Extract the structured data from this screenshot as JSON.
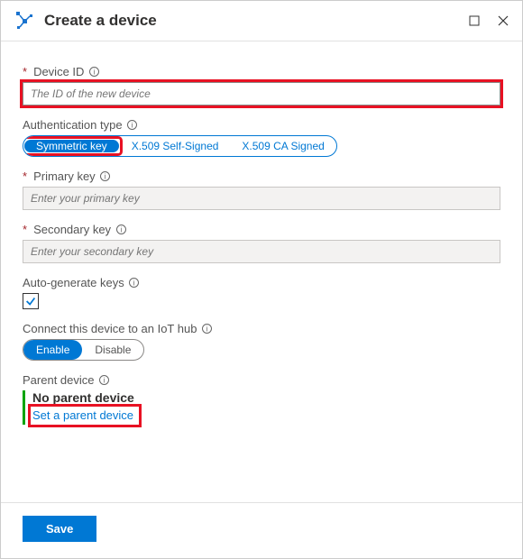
{
  "header": {
    "title": "Create a device"
  },
  "deviceId": {
    "label": "Device ID",
    "placeholder": "The ID of the new device"
  },
  "authType": {
    "label": "Authentication type",
    "options": [
      "Symmetric key",
      "X.509 Self-Signed",
      "X.509 CA Signed"
    ],
    "selected": "Symmetric key"
  },
  "primaryKey": {
    "label": "Primary key",
    "placeholder": "Enter your primary key"
  },
  "secondaryKey": {
    "label": "Secondary key",
    "placeholder": "Enter your secondary key"
  },
  "autoGenerate": {
    "label": "Auto-generate keys",
    "checked": true
  },
  "iotHub": {
    "label": "Connect this device to an IoT hub",
    "options": [
      "Enable",
      "Disable"
    ],
    "selected": "Enable"
  },
  "parentDevice": {
    "label": "Parent device",
    "status": "No parent device",
    "link": "Set a parent device"
  },
  "footer": {
    "save": "Save"
  }
}
